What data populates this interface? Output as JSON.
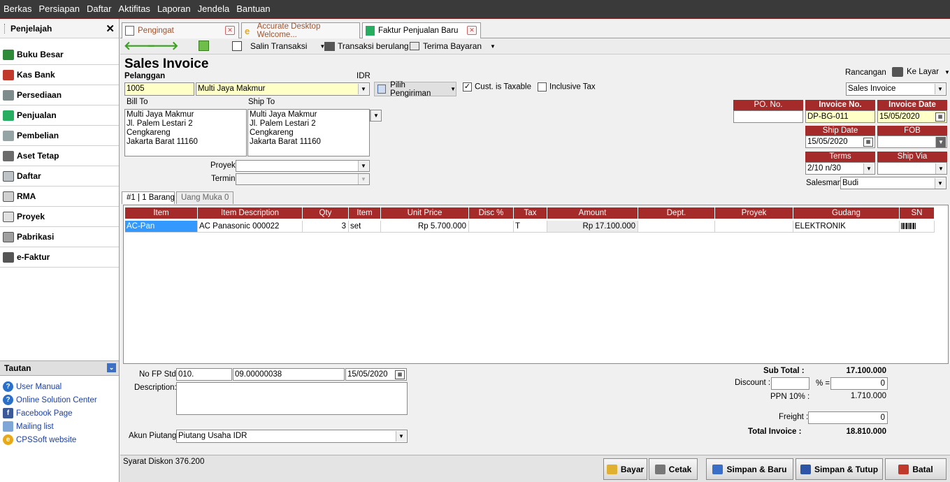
{
  "menu": [
    "Berkas",
    "Persiapan",
    "Daftar",
    "Aktifitas",
    "Laporan",
    "Jendela",
    "Bantuan"
  ],
  "sidebar": {
    "title": "Penjelajah",
    "close": "✕",
    "items": [
      {
        "label": "Buku Besar",
        "icon": "ledger-icon"
      },
      {
        "label": "Kas Bank",
        "icon": "bank-icon"
      },
      {
        "label": "Persediaan",
        "icon": "inventory-icon"
      },
      {
        "label": "Penjualan",
        "icon": "sales-icon"
      },
      {
        "label": "Pembelian",
        "icon": "cart-icon"
      },
      {
        "label": "Aset Tetap",
        "icon": "house-icon"
      },
      {
        "label": "Daftar",
        "icon": "list-icon"
      },
      {
        "label": "RMA",
        "icon": "rma-icon"
      },
      {
        "label": "Proyek",
        "icon": "project-icon"
      },
      {
        "label": "Pabrikasi",
        "icon": "factory-icon"
      },
      {
        "label": "e-Faktur",
        "icon": "efaktur-icon"
      }
    ],
    "tautan": {
      "title": "Tautan",
      "links": [
        "User Manual",
        "Online Solution Center",
        "Facebook Page",
        "Mailing list",
        "CPSSoft website"
      ]
    }
  },
  "tabs": [
    "Pengingat",
    "Accurate Desktop Welcome...",
    "Faktur Penjualan Baru"
  ],
  "toolbar": {
    "salin": "Salin Transaksi",
    "berulang": "Transaksi berulang",
    "terima": "Terima Bayaran"
  },
  "form": {
    "title": "Sales Invoice",
    "pelanggan_label": "Pelanggan",
    "currency": "IDR",
    "customer_code": "1005",
    "customer_name": "Multi Jaya Makmur",
    "pilih_pengiriman": "Pilih Pengiriman",
    "cust_taxable": "Cust. is Taxable",
    "cust_taxable_check": "✓",
    "inclusive_tax": "Inclusive Tax",
    "bill_to_label": "Bill To",
    "ship_to_label": "Ship To",
    "bill_to": [
      "Multi Jaya Makmur",
      "Jl. Palem Lestari 2",
      "Cengkareng",
      "Jakarta Barat 11160"
    ],
    "ship_to": [
      "Multi Jaya Makmur",
      "Jl. Palem Lestari 2",
      "Cengkareng",
      "Jakarta Barat 11160"
    ],
    "proyek_label": "Proyek",
    "termin_label": "Termin",
    "rancangan_label": "Rancangan",
    "ke_layar": "Ke Layar",
    "rancangan_value": "Sales Invoice",
    "po_label": "PO. No.",
    "po_value": "",
    "invoice_no_label": "Invoice No.",
    "invoice_no": "DP-BG-011",
    "invoice_date_label": "Invoice Date",
    "invoice_date": "15/05/2020",
    "ship_date_label": "Ship Date",
    "ship_date": "15/05/2020",
    "fob_label": "FOB",
    "terms_label": "Terms",
    "terms": "2/10 n/30",
    "ship_via_label": "Ship Via",
    "salesman_label": "Salesman",
    "salesman": "Budi"
  },
  "subtabs": [
    "#1 | 1 Barang",
    "Uang Muka   0"
  ],
  "grid": {
    "headers": [
      "Item",
      "Item Description",
      "Qty",
      "Item Unit",
      "Unit Price",
      "Disc %",
      "Tax",
      "Amount",
      "Dept.",
      "Proyek",
      "Gudang",
      "SN"
    ],
    "rows": [
      {
        "item": "AC-Pan",
        "desc": "AC Panasonic 000022",
        "qty": "3",
        "unit": "set",
        "price": "Rp 5.700.000",
        "disc": "",
        "tax": "T",
        "amount": "Rp 17.100.000",
        "dept": "",
        "proyek": "",
        "gudang": "ELEKTRONIK"
      }
    ]
  },
  "footer": {
    "no_fp_label": "No FP Std",
    "fp1": "010.",
    "fp2": "09.00000038",
    "fp_date": "15/05/2020",
    "description_label": "Description:",
    "akun_label": "Akun Piutang",
    "akun_value": "Piutang Usaha IDR",
    "subtotal_label": "Sub Total :",
    "subtotal": "17.100.000",
    "discount_label": "Discount :",
    "discount_pct_label": "% =",
    "discount_value": "0",
    "ppn_label": "PPN 10% :",
    "ppn": "1.710.000",
    "freight_label": "Freight :",
    "freight": "0",
    "total_label": "Total Invoice :",
    "total": "18.810.000",
    "syarat": "Syarat Diskon 376.200"
  },
  "buttons": {
    "bayar": "Bayar",
    "cetak": "Cetak",
    "simpan_baru": "Simpan & Baru",
    "simpan_tutup": "Simpan & Tutup",
    "batal": "Batal"
  },
  "colors": {
    "header_red": "#a52a2a",
    "yellow_field": "#ffffc8",
    "link_blue": "#1a3fa6"
  }
}
